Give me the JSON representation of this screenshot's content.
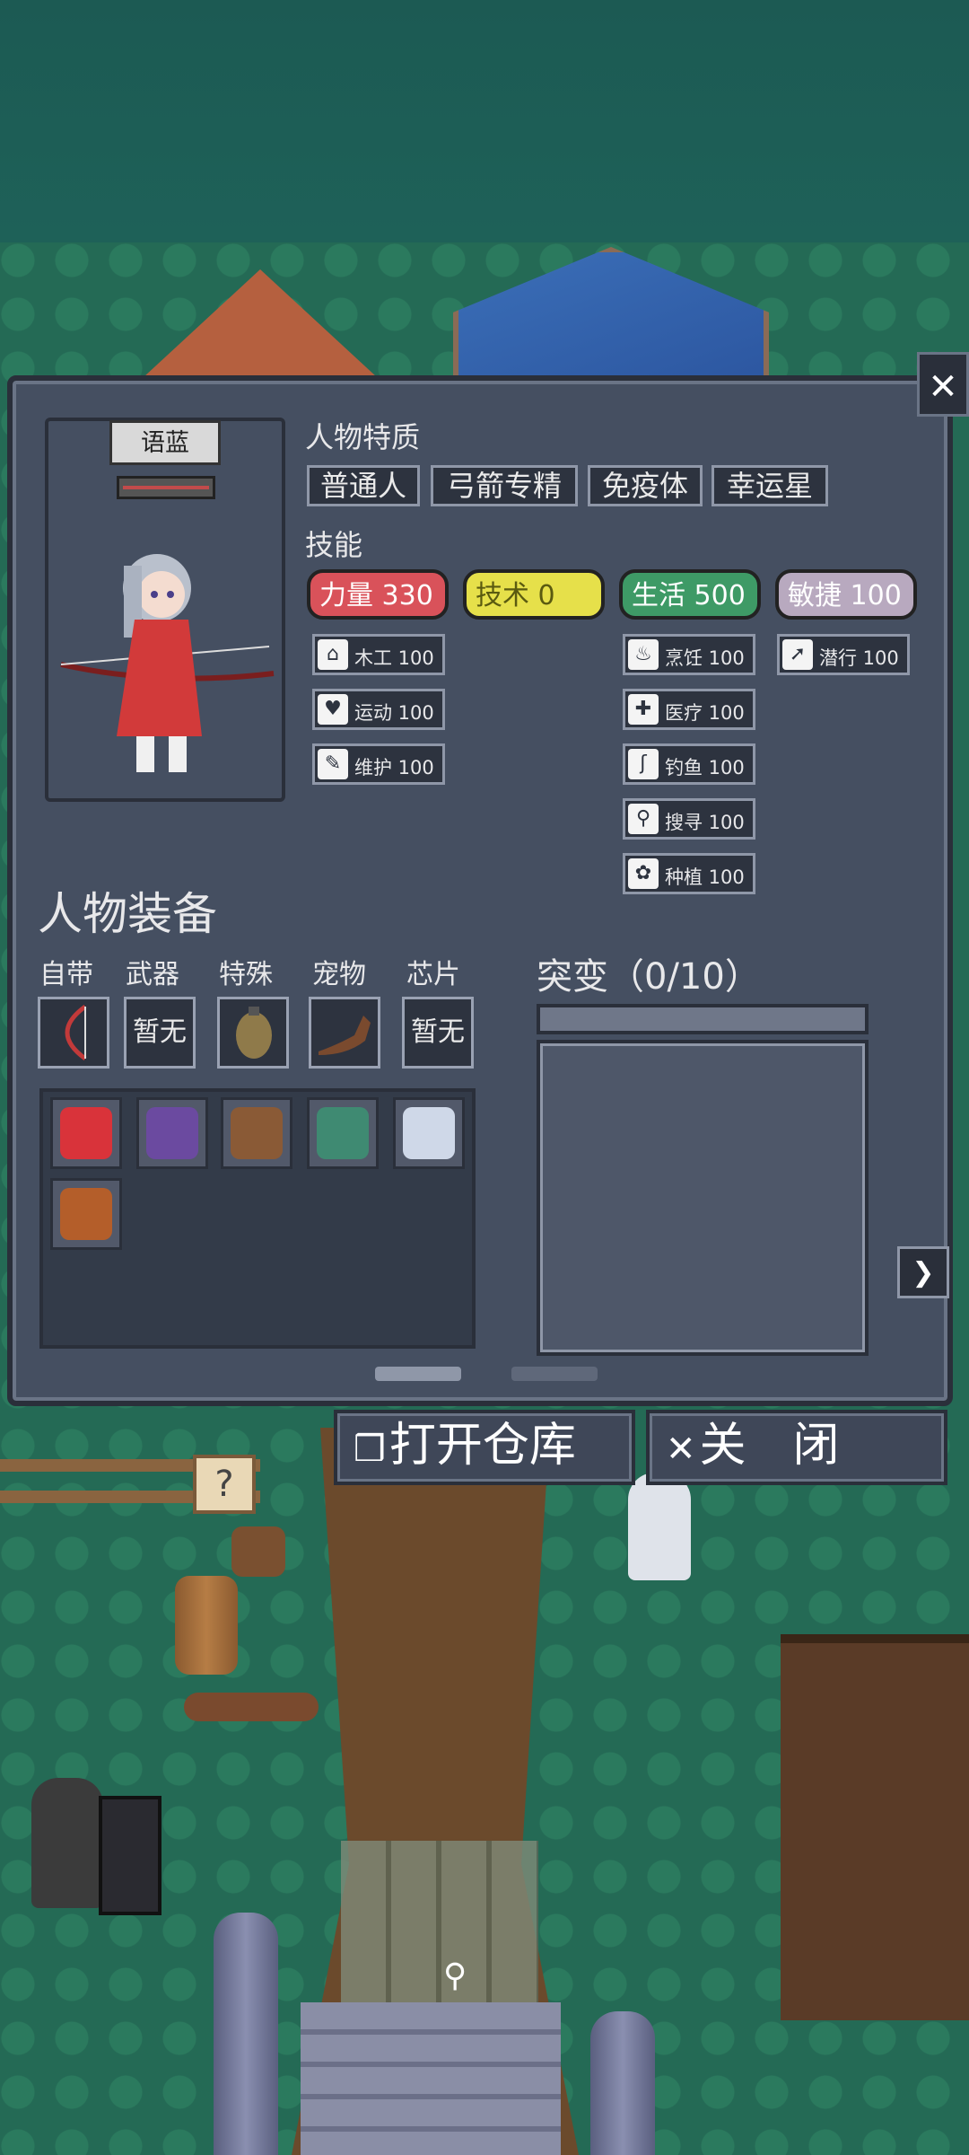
{
  "character": {
    "name": "语蓝"
  },
  "traits": {
    "title": "人物特质",
    "items": [
      "普通人",
      "弓箭专精",
      "免疫体",
      "幸运星"
    ]
  },
  "skills": {
    "title": "技能",
    "stats": [
      {
        "label": "力量 330",
        "color": "#d9525a"
      },
      {
        "label": "技术 0",
        "color": "#e6e04a"
      },
      {
        "label": "生活 500",
        "color": "#3e9a66"
      },
      {
        "label": "敏捷 100",
        "color": "#b8a9bf"
      }
    ],
    "strength": [
      {
        "icon": "house-icon",
        "glyph": "⌂",
        "label": "木工 100"
      },
      {
        "icon": "heart-icon",
        "glyph": "♥",
        "label": "运动 100"
      },
      {
        "icon": "wrench-icon",
        "glyph": "✎",
        "label": "维护 100"
      }
    ],
    "life": [
      {
        "icon": "cooking-pot-icon",
        "glyph": "♨",
        "label": "烹饪 100"
      },
      {
        "icon": "medkit-icon",
        "glyph": "✚",
        "label": "医疗 100"
      },
      {
        "icon": "fishing-icon",
        "glyph": "ʃ",
        "label": "钓鱼 100"
      },
      {
        "icon": "magnifier-icon",
        "glyph": "⚲",
        "label": "搜寻 100"
      },
      {
        "icon": "plant-icon",
        "glyph": "✿",
        "label": "种植 100"
      }
    ],
    "agility": [
      {
        "icon": "sneak-icon",
        "glyph": "➚",
        "label": "潜行 100"
      }
    ]
  },
  "equipment": {
    "title": "人物装备",
    "slots": [
      {
        "label": "自带",
        "value": "",
        "icon": "bow-icon"
      },
      {
        "label": "武器",
        "value": "暂无",
        "icon": ""
      },
      {
        "label": "特殊",
        "value": "",
        "icon": "grenade-icon"
      },
      {
        "label": "宠物",
        "value": "",
        "icon": "otter-icon"
      },
      {
        "label": "芯片",
        "value": "暂无",
        "icon": ""
      }
    ],
    "inventory": [
      {
        "icon": "first-aid-kit-icon",
        "color": "#d9333a"
      },
      {
        "icon": "purple-vest-icon",
        "color": "#6b4aa0"
      },
      {
        "icon": "brown-backpack-icon",
        "color": "#8a5a36"
      },
      {
        "icon": "green-backpack-icon",
        "color": "#3f8a72"
      },
      {
        "icon": "white-container-icon",
        "color": "#cfd8e8"
      },
      {
        "icon": "cloth-sack-icon",
        "color": "#b45e2a"
      }
    ]
  },
  "mutation": {
    "title": "突变（0/10）",
    "progress": 0
  },
  "buttons": {
    "open_storage": "打开仓库",
    "close": "关　闭"
  },
  "scene": {
    "sign": "?"
  }
}
